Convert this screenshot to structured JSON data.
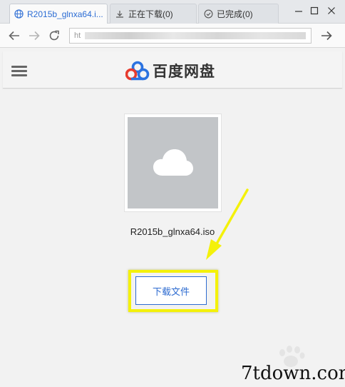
{
  "browser": {
    "tabs": [
      {
        "label": "R2015b_glnxa64.i..."
      },
      {
        "label": "正在下载(0)"
      },
      {
        "label": "已完成(0)"
      }
    ],
    "address": {
      "visible_prefix": "ht"
    },
    "accent_color": "#2b6cd4"
  },
  "site": {
    "logo_text": "百度网盘"
  },
  "file": {
    "name": "R2015b_glnxa64.iso",
    "download_label": "下载文件"
  },
  "annotation": {
    "highlight_color": "#f4f10a"
  },
  "watermark": {
    "text": "7tdown.com"
  }
}
